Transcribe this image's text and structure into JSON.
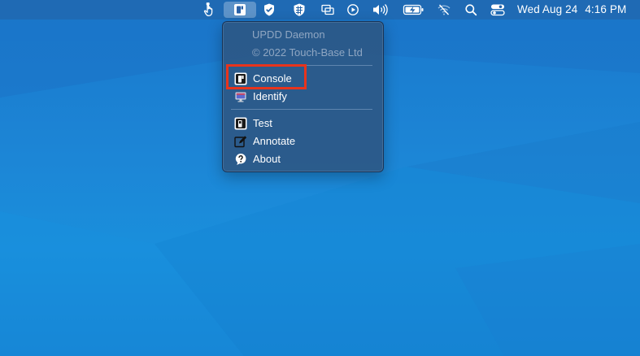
{
  "menubar": {
    "date": "Wed Aug 24",
    "time": "4:16 PM",
    "icons": [
      "touch-hand-icon",
      "updd-icon",
      "shield-check-icon",
      "shield-grid-icon",
      "display-mirror-icon",
      "play-circle-icon",
      "volume-icon",
      "battery-charging-icon",
      "wifi-off-icon",
      "search-icon",
      "control-center-icon"
    ]
  },
  "menu": {
    "header_title": "UPDD Daemon",
    "header_copyright": "© 2022 Touch-Base Ltd",
    "items": [
      {
        "label": "Console",
        "icon": "console-icon"
      },
      {
        "label": "Identify",
        "icon": "identify-monitor-icon"
      },
      {
        "label": "Test",
        "icon": "test-icon"
      },
      {
        "label": "Annotate",
        "icon": "annotate-pencil-icon"
      },
      {
        "label": "About",
        "icon": "about-question-icon"
      }
    ]
  },
  "annotation": {
    "highlight_color": "#e8341c",
    "highlighted_item": "Console"
  },
  "colors": {
    "desktop_blue": "#1c86d6",
    "menu_bg": "#2c5886",
    "menu_header_text": "#8fa6c2"
  }
}
